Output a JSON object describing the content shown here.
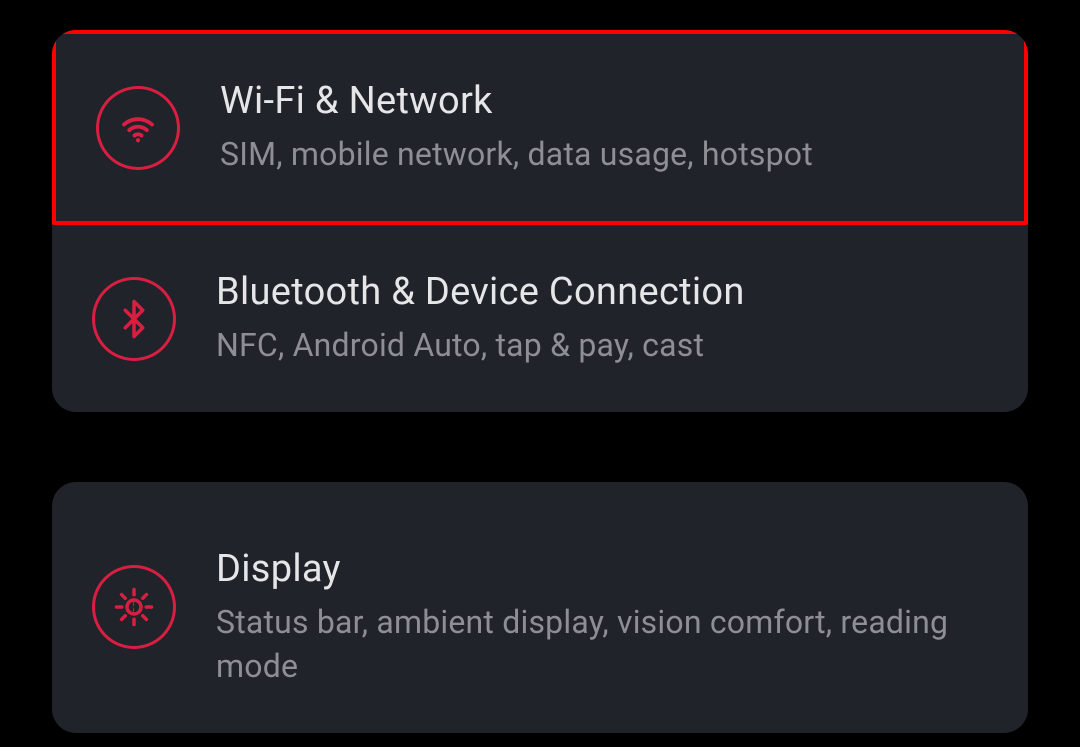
{
  "colors": {
    "accent": "#d81f41",
    "highlight": "#ff0000",
    "card_bg": "#20232a",
    "page_bg": "#000000",
    "title": "#e6e6e8",
    "subtitle": "#8e8f94"
  },
  "settings": {
    "group1": {
      "items": [
        {
          "icon": "wifi-icon",
          "title": "Wi-Fi & Network",
          "subtitle": "SIM, mobile network, data usage, hotspot",
          "highlighted": true
        },
        {
          "icon": "bluetooth-icon",
          "title": "Bluetooth & Device Connection",
          "subtitle": "NFC, Android Auto, tap & pay, cast",
          "highlighted": false
        }
      ]
    },
    "group2": {
      "items": [
        {
          "icon": "display-icon",
          "title": "Display",
          "subtitle": "Status bar, ambient display, vision comfort, reading mode",
          "highlighted": false
        }
      ]
    }
  }
}
